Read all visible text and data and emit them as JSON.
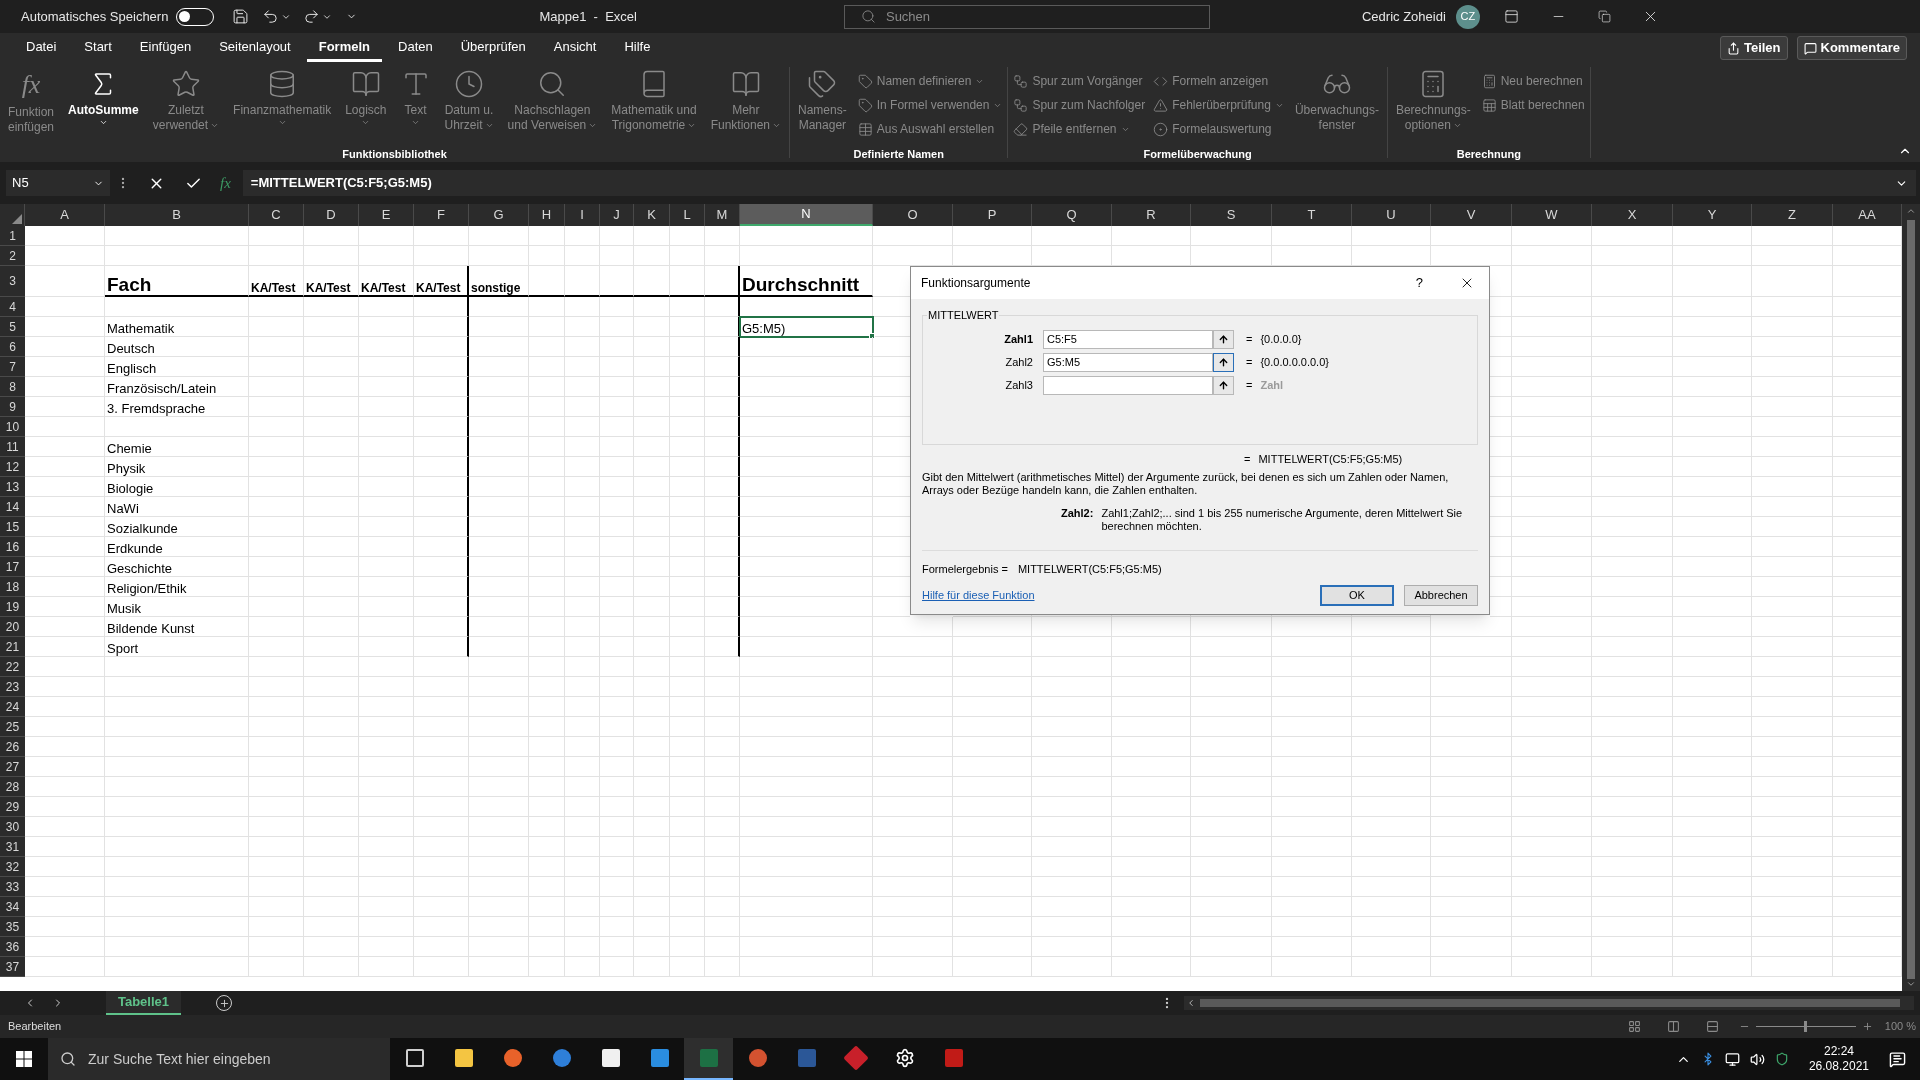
{
  "title_bar": {
    "autosave_label": "Automatisches Speichern",
    "autosave_on": false,
    "document_title": "Mappe1  -  Excel",
    "search_placeholder": "Suchen",
    "user_name": "Cedric Zoheidi",
    "user_initials": "CZ"
  },
  "menu_tabs": [
    {
      "label": "Datei",
      "selected": false
    },
    {
      "label": "Start",
      "selected": false
    },
    {
      "label": "Einfügen",
      "selected": false
    },
    {
      "label": "Seitenlayout",
      "selected": false
    },
    {
      "label": "Formeln",
      "selected": true
    },
    {
      "label": "Daten",
      "selected": false
    },
    {
      "label": "Überprüfen",
      "selected": false
    },
    {
      "label": "Ansicht",
      "selected": false
    },
    {
      "label": "Hilfe",
      "selected": false
    }
  ],
  "share_button": "Teilen",
  "comments_button": "Kommentare",
  "ribbon_groups": [
    {
      "label": "Funktionsbibliothek",
      "items": [
        {
          "kind": "large",
          "label": "Funktion\neinfügen",
          "glyph": "fx",
          "disabled": true,
          "has_menu": false
        },
        {
          "kind": "large",
          "label": "AutoSumme",
          "disabled": false,
          "has_menu": true
        },
        {
          "kind": "large",
          "label": "Zuletzt\nverwendet",
          "disabled": true,
          "has_menu": true
        },
        {
          "kind": "large",
          "label": "Finanzmathematik",
          "disabled": true,
          "has_menu": true
        },
        {
          "kind": "large",
          "label": "Logisch",
          "disabled": true,
          "has_menu": true
        },
        {
          "kind": "large",
          "label": "Text",
          "disabled": true,
          "has_menu": true
        },
        {
          "kind": "large",
          "label": "Datum u.\nUhrzeit",
          "disabled": true,
          "has_menu": true
        },
        {
          "kind": "large",
          "label": "Nachschlagen\nund Verweisen",
          "disabled": true,
          "has_menu": true
        },
        {
          "kind": "large",
          "label": "Mathematik und\nTrigonometrie",
          "disabled": true,
          "has_menu": true
        },
        {
          "kind": "large",
          "label": "Mehr\nFunktionen",
          "disabled": true,
          "has_menu": true
        }
      ]
    },
    {
      "label": "Definierte Namen",
      "items": [
        {
          "kind": "large",
          "label": "Namens-\nManager",
          "disabled": true,
          "has_menu": false
        },
        {
          "kind": "stack",
          "items": [
            {
              "label": "Namen definieren",
              "disabled": true,
              "has_menu": true
            },
            {
              "label": "In Formel verwenden",
              "disabled": true,
              "has_menu": true
            },
            {
              "label": "Aus Auswahl erstellen",
              "disabled": true,
              "has_menu": false
            }
          ]
        }
      ]
    },
    {
      "label": "Formelüberwachung",
      "items": [
        {
          "kind": "stack",
          "items": [
            {
              "label": "Spur zum Vorgänger",
              "disabled": true,
              "has_menu": false
            },
            {
              "label": "Spur zum Nachfolger",
              "disabled": true,
              "has_menu": false
            },
            {
              "label": "Pfeile entfernen",
              "disabled": true,
              "has_menu": true
            }
          ]
        },
        {
          "kind": "stack",
          "items": [
            {
              "label": "Formeln anzeigen",
              "disabled": true,
              "has_menu": false
            },
            {
              "label": "Fehlerüberprüfung",
              "disabled": true,
              "has_menu": true
            },
            {
              "label": "Formelauswertung",
              "disabled": true,
              "has_menu": false
            }
          ]
        },
        {
          "kind": "large",
          "label": "Überwachungs-\nfenster",
          "disabled": true,
          "has_menu": false
        }
      ]
    },
    {
      "label": "Berechnung",
      "items": [
        {
          "kind": "large",
          "label": "Berechnungs-\noptionen",
          "disabled": true,
          "has_menu": true
        },
        {
          "kind": "stack",
          "items": [
            {
              "label": "Neu berechnen",
              "disabled": true,
              "has_menu": false
            },
            {
              "label": "Blatt berechnen",
              "disabled": true,
              "has_menu": false
            }
          ]
        }
      ]
    }
  ],
  "formula_bar": {
    "name_box": "N5",
    "function_glyph": "fx",
    "formula": "=MITTELWERT(C5:F5;G5:M5)"
  },
  "sheet": {
    "columns": [
      {
        "label": "A",
        "selected": false
      },
      {
        "label": "B",
        "selected": false
      },
      {
        "label": "C",
        "selected": false
      },
      {
        "label": "D",
        "selected": false
      },
      {
        "label": "E",
        "selected": false
      },
      {
        "label": "F",
        "selected": false
      },
      {
        "label": "G",
        "selected": false
      },
      {
        "label": "H",
        "selected": false
      },
      {
        "label": "I",
        "selected": false
      },
      {
        "label": "J",
        "selected": false
      },
      {
        "label": "K",
        "selected": false
      },
      {
        "label": "L",
        "selected": false
      },
      {
        "label": "M",
        "selected": false
      },
      {
        "label": "N",
        "selected": true
      },
      {
        "label": "O",
        "selected": false
      },
      {
        "label": "P",
        "selected": false
      },
      {
        "label": "Q",
        "selected": false
      },
      {
        "label": "R",
        "selected": false
      },
      {
        "label": "S",
        "selected": false
      },
      {
        "label": "T",
        "selected": false
      },
      {
        "label": "U",
        "selected": false
      },
      {
        "label": "V",
        "selected": false
      },
      {
        "label": "W",
        "selected": false
      },
      {
        "label": "X",
        "selected": false
      },
      {
        "label": "Y",
        "selected": false
      },
      {
        "label": "Z",
        "selected": false
      },
      {
        "label": "AA",
        "selected": false
      }
    ],
    "rows": [
      {
        "number": "1"
      },
      {
        "number": "2"
      },
      {
        "number": "3",
        "kind": "heading",
        "cells": {
          "B": {
            "text": "Fach",
            "selected": false
          },
          "C": {
            "text": "KA/Test",
            "selected": false
          },
          "D": {
            "text": "KA/Test",
            "selected": false
          },
          "E": {
            "text": "KA/Test",
            "selected": false
          },
          "F": {
            "text": "KA/Test",
            "selected": false
          },
          "G": {
            "text": "sonstige",
            "selected": false
          },
          "N": {
            "text": "Durchschnitt",
            "selected": false
          }
        }
      },
      {
        "number": "4"
      },
      {
        "number": "5",
        "cells": {
          "B": {
            "text": "Mathematik",
            "selected": false
          },
          "N": {
            "text": "G5:M5)",
            "selected": true
          }
        }
      },
      {
        "number": "6",
        "cells": {
          "B": {
            "text": "Deutsch",
            "selected": false
          }
        }
      },
      {
        "number": "7",
        "cells": {
          "B": {
            "text": "Englisch",
            "selected": false
          }
        }
      },
      {
        "number": "8",
        "cells": {
          "B": {
            "text": "Französisch/Latein",
            "selected": false
          }
        }
      },
      {
        "number": "9",
        "cells": {
          "B": {
            "text": "3. Fremdsprache",
            "selected": false
          }
        }
      },
      {
        "number": "10"
      },
      {
        "number": "11",
        "cells": {
          "B": {
            "text": "Chemie",
            "selected": false
          }
        }
      },
      {
        "number": "12",
        "cells": {
          "B": {
            "text": "Physik",
            "selected": false
          }
        }
      },
      {
        "number": "13",
        "cells": {
          "B": {
            "text": "Biologie",
            "selected": false
          }
        }
      },
      {
        "number": "14",
        "cells": {
          "B": {
            "text": "NaWi",
            "selected": false
          }
        }
      },
      {
        "number": "15",
        "cells": {
          "B": {
            "text": "Sozialkunde",
            "selected": false
          }
        }
      },
      {
        "number": "16",
        "cells": {
          "B": {
            "text": "Erdkunde",
            "selected": false
          }
        }
      },
      {
        "number": "17",
        "cells": {
          "B": {
            "text": "Geschichte",
            "selected": false
          }
        }
      },
      {
        "number": "18",
        "cells": {
          "B": {
            "text": "Religion/Ethik",
            "selected": false
          }
        }
      },
      {
        "number": "19",
        "cells": {
          "B": {
            "text": "Musik",
            "selected": false
          }
        }
      },
      {
        "number": "20",
        "cells": {
          "B": {
            "text": "Bildende Kunst",
            "selected": false
          }
        }
      },
      {
        "number": "21",
        "cells": {
          "B": {
            "text": "Sport",
            "selected": false
          }
        }
      },
      {
        "number": "22"
      },
      {
        "number": "23"
      },
      {
        "number": "24"
      },
      {
        "number": "25"
      },
      {
        "number": "26"
      },
      {
        "number": "27"
      },
      {
        "number": "28"
      },
      {
        "number": "29"
      },
      {
        "number": "30"
      },
      {
        "number": "31"
      },
      {
        "number": "32"
      },
      {
        "number": "33"
      },
      {
        "number": "34"
      },
      {
        "number": "35"
      },
      {
        "number": "36"
      },
      {
        "number": "37"
      }
    ]
  },
  "dialog": {
    "title": "Funktionsargumente",
    "help_glyph": "?",
    "function_name": "MITTELWERT",
    "arguments": [
      {
        "label": "Zahl1",
        "value": "C5:F5",
        "equals": "=",
        "result": "{0.0.0.0}",
        "required": true,
        "focused": false,
        "result_is_hint": false
      },
      {
        "label": "Zahl2",
        "value": "G5:M5",
        "equals": "=",
        "result": "{0.0.0.0.0.0.0}",
        "required": false,
        "focused": true,
        "result_is_hint": false
      },
      {
        "label": "Zahl3",
        "equals": "=",
        "result": "Zahl",
        "required": false,
        "focused": false,
        "result_is_hint": true
      }
    ],
    "result_equals": "=",
    "result_preview": "MITTELWERT(C5:F5;G5:M5)",
    "description": "Gibt den Mittelwert (arithmetisches Mittel) der Argumente zurück, bei denen es sich um Zahlen oder Namen, Arrays oder Bezüge handeln kann, die Zahlen enthalten.",
    "argument_help_label": "Zahl2:",
    "argument_help": "Zahl1;Zahl2;... sind 1 bis 255 numerische Argumente, deren Mittelwert Sie berechnen möchten.",
    "result_label": "Formelergebnis =",
    "result_value": "MITTELWERT(C5:F5;G5:M5)",
    "help_link": "Hilfe für diese Funktion",
    "buttons": [
      {
        "label": "OK",
        "default": true
      },
      {
        "label": "Abbrechen",
        "default": false
      }
    ]
  },
  "sheet_tabs": [
    {
      "label": "Tabelle1",
      "selected": true
    }
  ],
  "status_bar": {
    "mode": "Bearbeiten",
    "zoom": {
      "level": 0.5,
      "reading": "100 %"
    }
  },
  "taskbar": {
    "search_placeholder": "Zur Suche Text hier eingeben",
    "apps": [
      {
        "kind": "taskview",
        "active": false
      },
      {
        "kind": "explorer",
        "active": false
      },
      {
        "kind": "firefox",
        "active": false
      },
      {
        "kind": "mail",
        "active": false
      },
      {
        "kind": "store",
        "active": false
      },
      {
        "kind": "calendar",
        "active": false
      },
      {
        "kind": "excel",
        "active": true
      },
      {
        "kind": "powerpoint",
        "active": false
      },
      {
        "kind": "word",
        "active": false
      },
      {
        "kind": "game",
        "active": false
      },
      {
        "kind": "settings",
        "active": false
      },
      {
        "kind": "acrobat",
        "active": false
      }
    ],
    "time": "22:24",
    "date": "26.08.2021"
  }
}
